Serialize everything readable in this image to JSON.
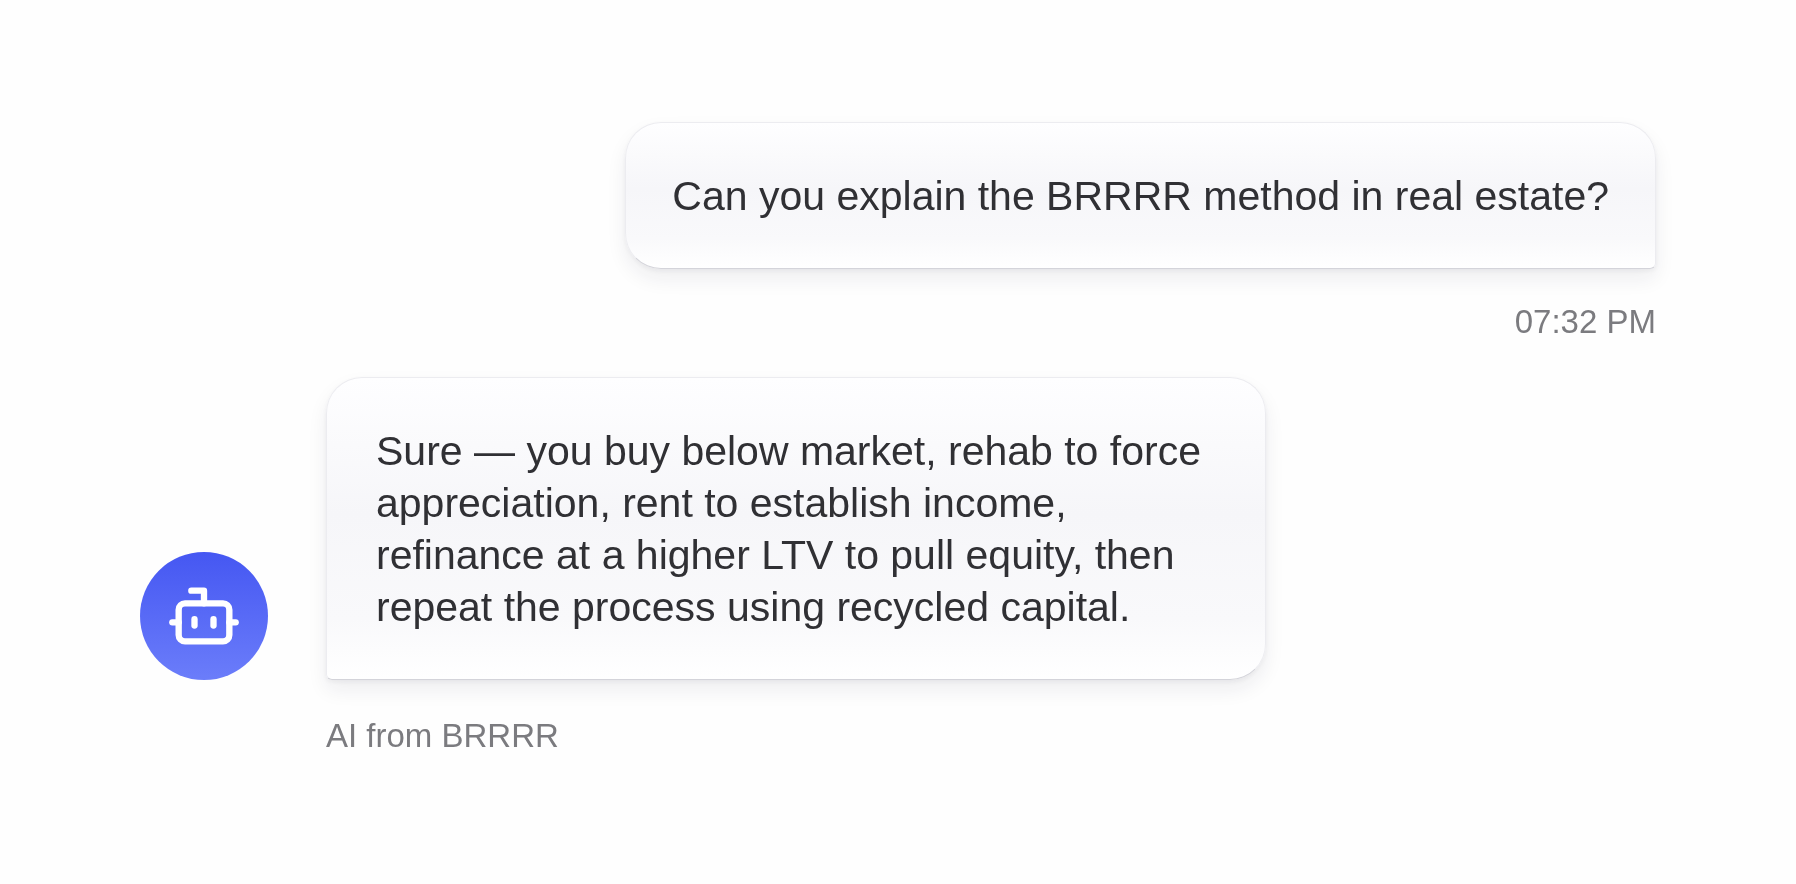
{
  "messages": [
    {
      "kind": "user",
      "text": "Can you explain the BRRRR method in real estate?",
      "meta": "07:32 PM"
    },
    {
      "kind": "assistant",
      "text": "Sure — you buy below market, rehab to force appreciation, rent to establish income, refinance at a higher LTV to pull equity, then repeat the process using recycled capital.",
      "meta": "AI from BRRRR"
    }
  ]
}
